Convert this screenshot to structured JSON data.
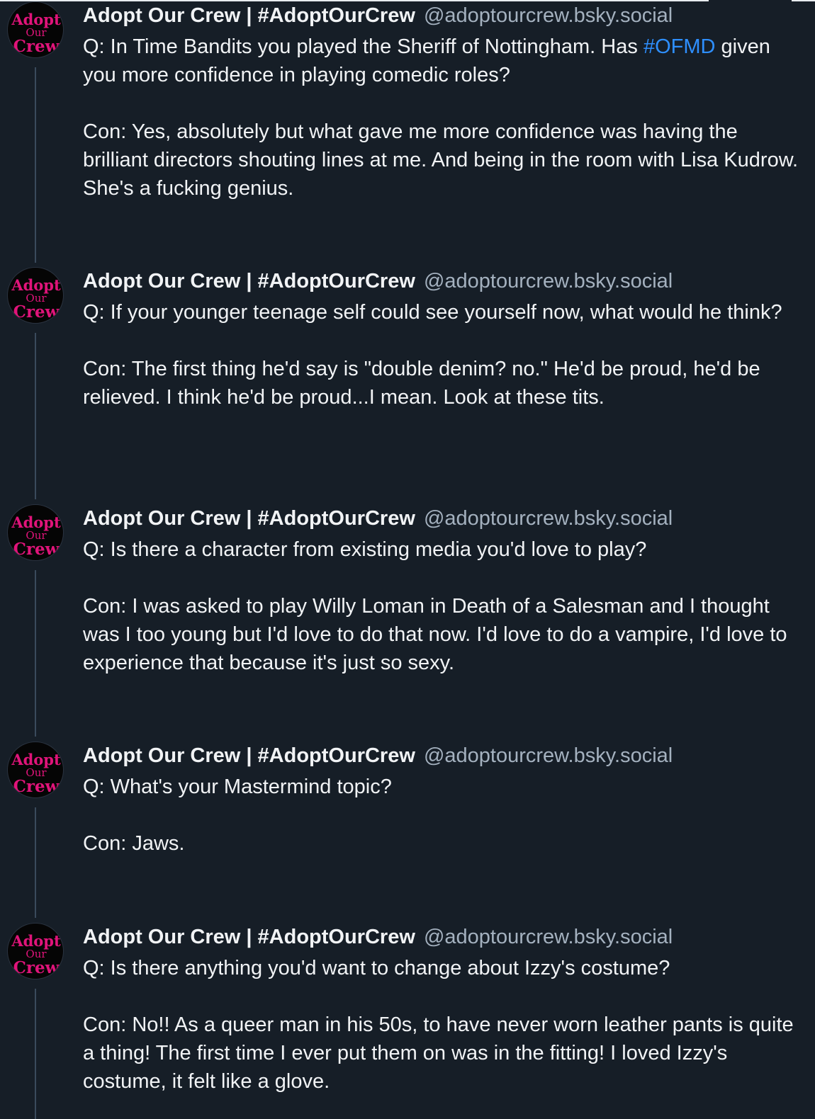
{
  "author": {
    "name": "Adopt Our Crew | #AdoptOurCrew",
    "handle": "@adoptourcrew.bsky.social",
    "avatar_text": [
      "Adopt",
      "Our",
      "Crew"
    ]
  },
  "colors": {
    "background": "#161e27",
    "text": "#f1f3f5",
    "handle": "#a4b1bf",
    "hashtag": "#2e8fff",
    "avatar_logo": "#e0147a",
    "thread_line": "#3a4a5c"
  },
  "posts": [
    {
      "question_before_tag": "Q: In Time Bandits you played the Sheriff of Nottingham. Has ",
      "hashtag": "#OFMD",
      "question_after_tag": " given you more confidence in playing comedic roles?",
      "answer": "Con: Yes, absolutely but what gave me more confidence was having the brilliant directors shouting lines at me. And being in the room with Lisa Kudrow. She's a fucking genius."
    },
    {
      "question": "Q: If your younger teenage self could see yourself now, what would he think?",
      "answer": "Con: The first thing he'd say is \"double denim? no.\" He'd be proud, he'd be relieved. I think he'd be proud...I mean. Look at these tits."
    },
    {
      "question": "Q: Is there a character from existing media you'd love to play?",
      "answer": "Con: I was asked to play Willy Loman in Death of a Salesman and I thought was I too young but I'd love to do that now. I'd love to do a vampire, I'd love to experience that because it's just so sexy."
    },
    {
      "question": "Q: What's your Mastermind topic?",
      "answer": "Con: Jaws."
    },
    {
      "question": "Q: Is there anything you'd want to change about Izzy's costume?",
      "answer": "Con: No!! As a queer man in his 50s, to have never worn leather pants is quite a thing! The first time I ever put them on was in the fitting! I loved Izzy's costume, it felt like a glove."
    }
  ]
}
